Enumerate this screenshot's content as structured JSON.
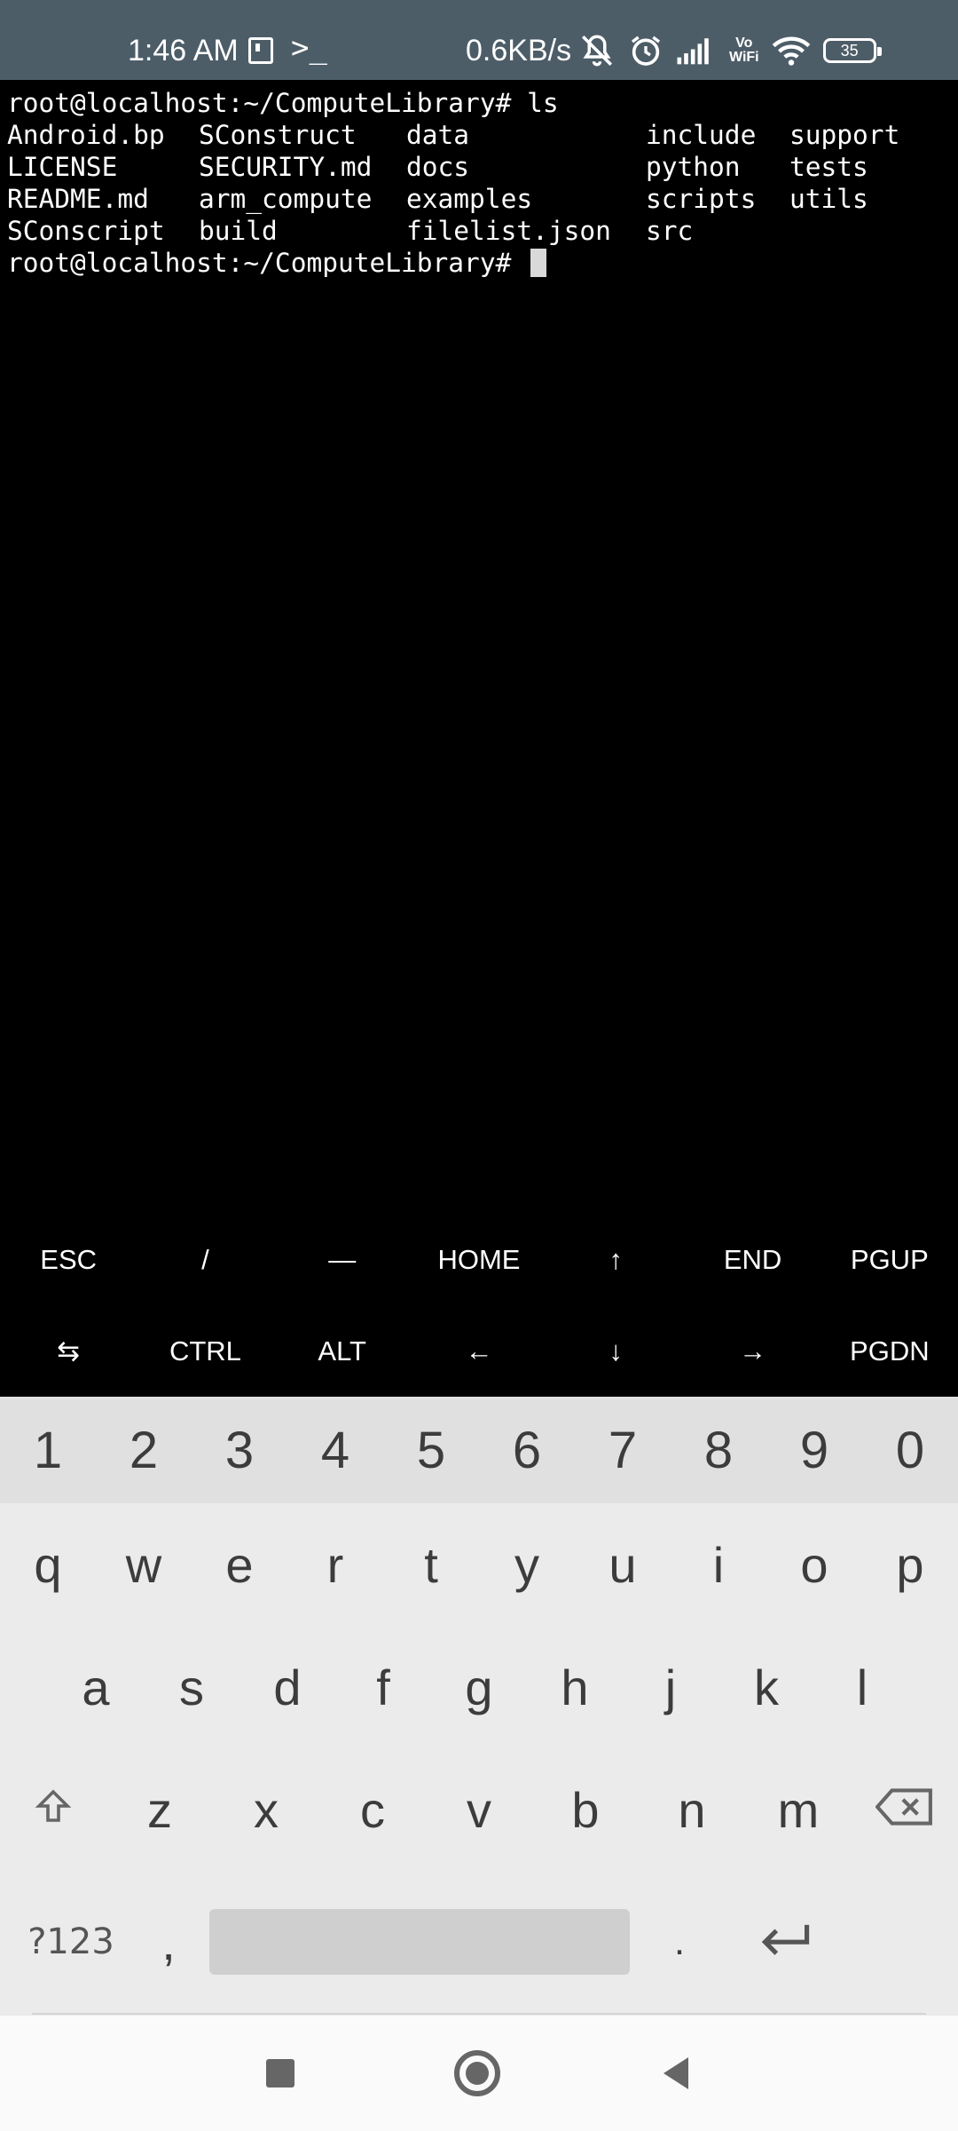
{
  "status_bar": {
    "time": "1:46 AM",
    "terminal_indicator": ">_",
    "net_speed": "0.6KB/s",
    "vowifi_top": "Vo",
    "vowifi_bottom": "WiFi",
    "battery": "35"
  },
  "terminal": {
    "prompt_line_1": "root@localhost:~/ComputeLibrary# ls",
    "ls_rows": [
      [
        "Android.bp",
        "SConstruct",
        "data",
        "include",
        "support"
      ],
      [
        "LICENSE",
        "SECURITY.md",
        "docs",
        "python",
        "tests"
      ],
      [
        "README.md",
        "arm_compute",
        "examples",
        "scripts",
        "utils"
      ],
      [
        "SConscript",
        "build",
        "filelist.json",
        "src",
        ""
      ]
    ],
    "prompt_line_2": "root@localhost:~/ComputeLibrary# "
  },
  "extra_keys": {
    "row1": [
      "ESC",
      "/",
      "—",
      "HOME",
      "↑",
      "END",
      "PGUP"
    ],
    "row2": [
      "⇆",
      "CTRL",
      "ALT",
      "←",
      "↓",
      "→",
      "PGDN"
    ]
  },
  "keyboard": {
    "numbers": [
      "1",
      "2",
      "3",
      "4",
      "5",
      "6",
      "7",
      "8",
      "9",
      "0"
    ],
    "row_q": [
      "q",
      "w",
      "e",
      "r",
      "t",
      "y",
      "u",
      "i",
      "o",
      "p"
    ],
    "row_a": [
      "a",
      "s",
      "d",
      "f",
      "g",
      "h",
      "j",
      "k",
      "l"
    ],
    "row_z": [
      "z",
      "x",
      "c",
      "v",
      "b",
      "n",
      "m"
    ],
    "symbols_key": "?123",
    "comma": ",",
    "period": "."
  }
}
